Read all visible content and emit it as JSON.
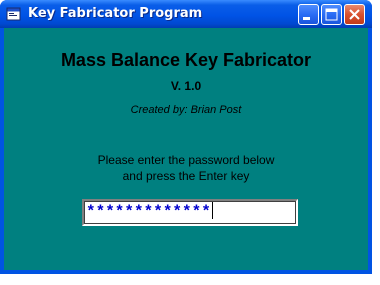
{
  "window": {
    "title": "Key Fabricator Program"
  },
  "main": {
    "heading": "Mass Balance Key Fabricator",
    "version": "V. 1.0",
    "credit": "Created by: Brian Post",
    "instruction_line1": "Please enter the password below",
    "instruction_line2": "and press the Enter key"
  },
  "password": {
    "value": "*************"
  },
  "icons": {
    "app": "app-window-icon",
    "minimize": "minimize-icon",
    "maximize": "maximize-icon",
    "close": "close-icon"
  },
  "colors": {
    "client_background": "#008080",
    "titlebar": "#0054e3",
    "close_button": "#d9512f",
    "password_text": "#0000cc"
  }
}
